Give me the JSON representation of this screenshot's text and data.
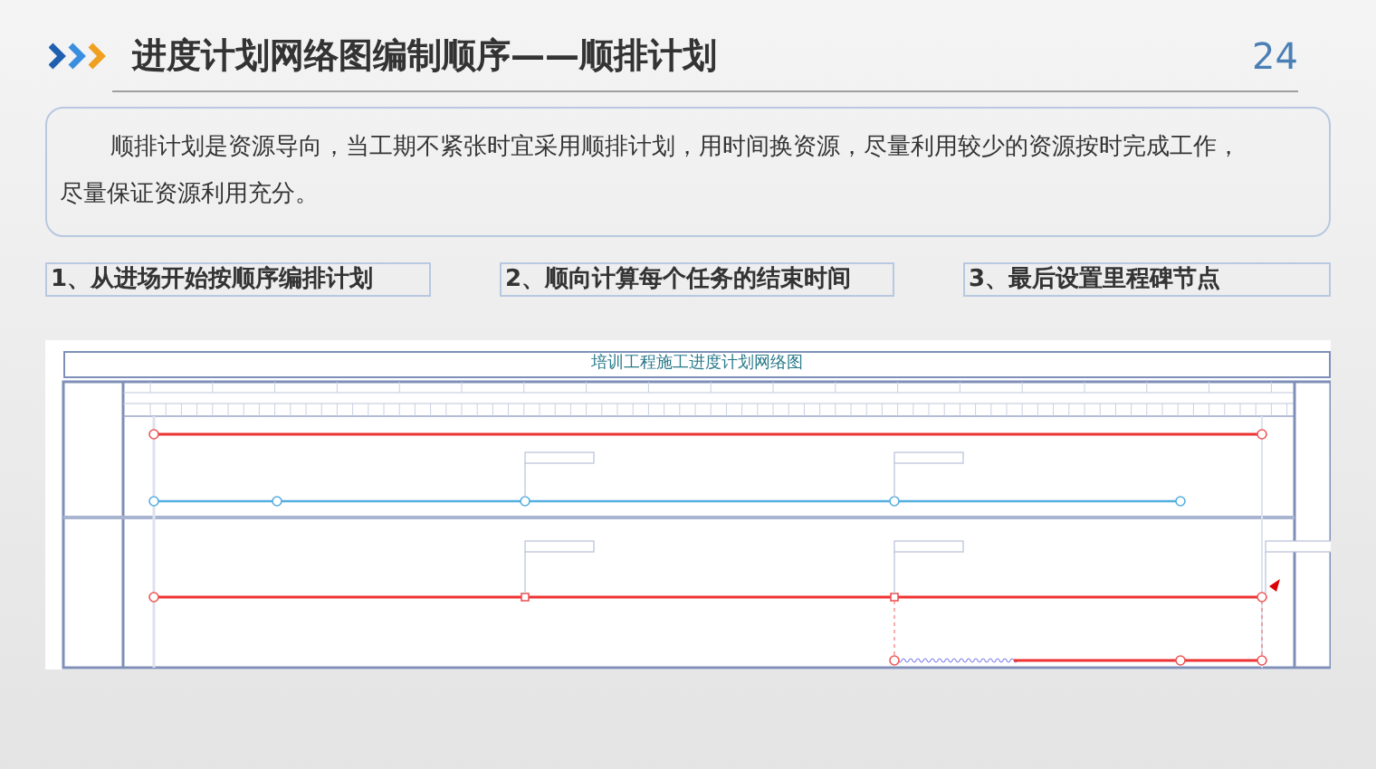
{
  "header": {
    "title": "进度计划网络图编制顺序——顺排计划",
    "page_number": "24"
  },
  "intro": {
    "text": "顺排计划是资源导向，当工期不紧张时宜采用顺排计划，用时间换资源，尽量利用较少的资源按时完成工作，尽量保证资源利用充分。"
  },
  "steps": [
    {
      "label": "1、从进场开始按顺序编排计划"
    },
    {
      "label": "2、顺向计算每个任务的结束时间"
    },
    {
      "label": "3、最后设置里程碑节点"
    }
  ],
  "diagram": {
    "title": "培训工程施工进度计划网络图"
  }
}
